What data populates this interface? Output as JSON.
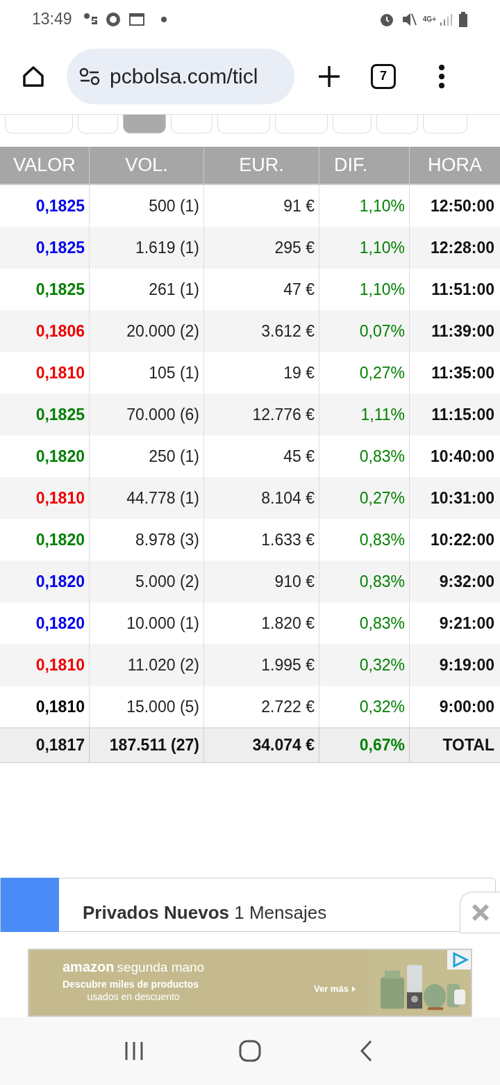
{
  "status_bar": {
    "time": "13:49",
    "network": "4G+"
  },
  "browser": {
    "url": "pcbolsa.com/ticl",
    "tab_count": "7"
  },
  "tabs": [
    {
      "selected": false
    },
    {
      "selected": false
    },
    {
      "selected": true
    },
    {
      "selected": false
    },
    {
      "selected": false
    },
    {
      "selected": false
    },
    {
      "selected": false
    },
    {
      "selected": false
    },
    {
      "selected": false
    }
  ],
  "table": {
    "columns": [
      "VALOR",
      "VOL.",
      "EUR.",
      "DIF.",
      "HORA"
    ],
    "rows": [
      {
        "price": "0,1825",
        "color": "#0000ee",
        "volume": "500 (1)",
        "eur": "91 €",
        "diff": "1,10%",
        "time": "12:50:00"
      },
      {
        "price": "0,1825",
        "color": "#0000ee",
        "volume": "1.619 (1)",
        "eur": "295 €",
        "diff": "1,10%",
        "time": "12:28:00"
      },
      {
        "price": "0,1825",
        "color": "#008000",
        "volume": "261 (1)",
        "eur": "47 €",
        "diff": "1,10%",
        "time": "11:51:00"
      },
      {
        "price": "0,1806",
        "color": "#ee0000",
        "volume": "20.000 (2)",
        "eur": "3.612 €",
        "diff": "0,07%",
        "time": "11:39:00"
      },
      {
        "price": "0,1810",
        "color": "#ee0000",
        "volume": "105 (1)",
        "eur": "19 €",
        "diff": "0,27%",
        "time": "11:35:00"
      },
      {
        "price": "0,1825",
        "color": "#008000",
        "volume": "70.000 (6)",
        "eur": "12.776 €",
        "diff": "1,11%",
        "time": "11:15:00"
      },
      {
        "price": "0,1820",
        "color": "#008000",
        "volume": "250 (1)",
        "eur": "45 €",
        "diff": "0,83%",
        "time": "10:40:00"
      },
      {
        "price": "0,1810",
        "color": "#ee0000",
        "volume": "44.778 (1)",
        "eur": "8.104 €",
        "diff": "0,27%",
        "time": "10:31:00"
      },
      {
        "price": "0,1820",
        "color": "#008000",
        "volume": "8.978 (3)",
        "eur": "1.633 €",
        "diff": "0,83%",
        "time": "10:22:00"
      },
      {
        "price": "0,1820",
        "color": "#0000ee",
        "volume": "5.000 (2)",
        "eur": "910 €",
        "diff": "0,83%",
        "time": "9:32:00"
      },
      {
        "price": "0,1820",
        "color": "#0000ee",
        "volume": "10.000 (1)",
        "eur": "1.820 €",
        "diff": "0,83%",
        "time": "9:21:00"
      },
      {
        "price": "0,1810",
        "color": "#ee0000",
        "volume": "11.020 (2)",
        "eur": "1.995 €",
        "diff": "0,32%",
        "time": "9:19:00"
      },
      {
        "price": "0,1810",
        "color": "#000000",
        "volume": "15.000 (5)",
        "eur": "2.722 €",
        "diff": "0,32%",
        "time": "9:00:00"
      }
    ],
    "total": {
      "price": "0,1817",
      "volume": "187.511 (27)",
      "eur": "34.074 €",
      "diff": "0,67%",
      "label": "TOTAL"
    }
  },
  "notification": {
    "text": "**Privados Nuevos** 1 Mensajes"
  },
  "ad": {
    "brand": "amazon",
    "brand_suffix": "segunda mano",
    "line1": "Descubre miles de productos",
    "line2": "usados en descuento",
    "cta": "Ver más"
  }
}
